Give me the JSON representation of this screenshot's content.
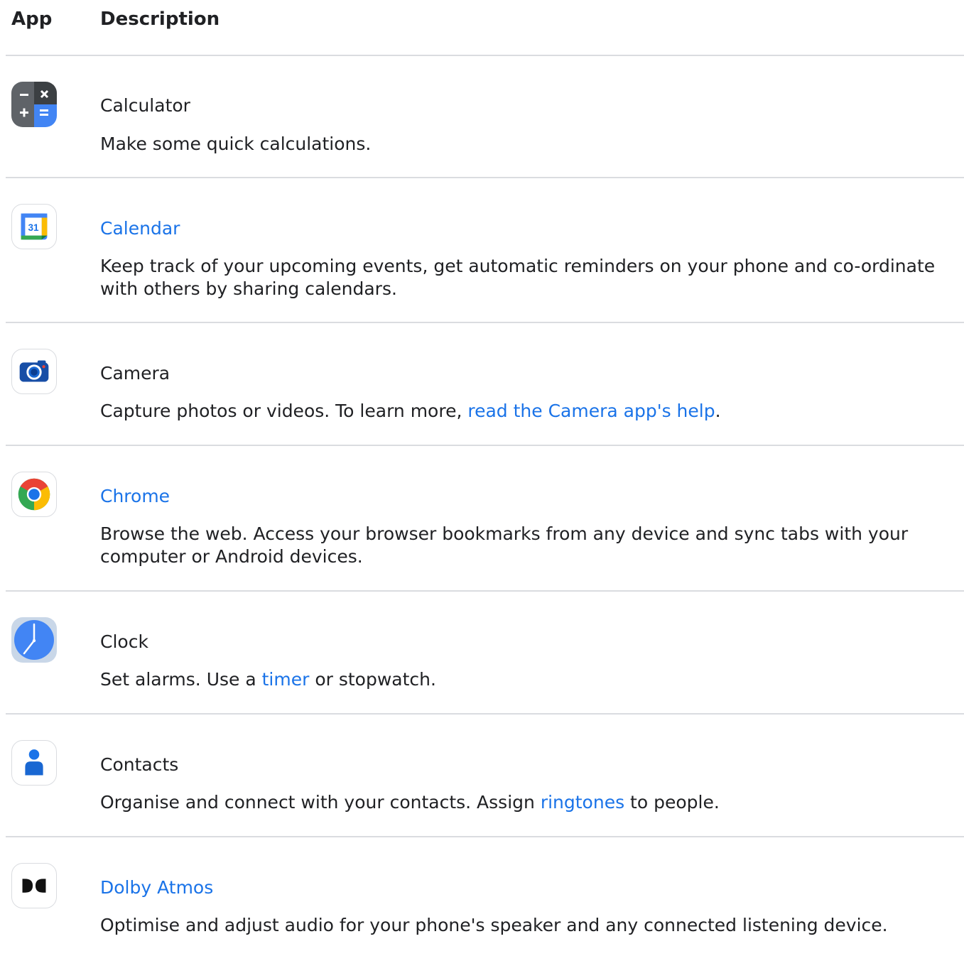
{
  "header": {
    "col_app": "App",
    "col_description": "Description"
  },
  "rows": [
    {
      "icon": "calculator-icon",
      "name": "Calculator",
      "desc": "Make some quick calculations."
    },
    {
      "icon": "calendar-icon",
      "name": "Calendar",
      "icon_text": "31",
      "desc": "Keep track of your upcoming events, get automatic reminders on your phone and co-ordinate with others by sharing calendars."
    },
    {
      "icon": "camera-icon",
      "name": "Camera",
      "desc_before": "Capture photos or videos. To learn more, ",
      "desc_link": "read the Camera app's help",
      "desc_after": "."
    },
    {
      "icon": "chrome-icon",
      "name": "Chrome",
      "desc": "Browse the web. Access your browser bookmarks from any device and sync tabs with your computer or Android devices."
    },
    {
      "icon": "clock-icon",
      "name": "Clock",
      "desc_before": "Set alarms. Use a ",
      "desc_link": "timer",
      "desc_after": " or stopwatch."
    },
    {
      "icon": "contacts-icon",
      "name": "Contacts",
      "desc_before": "Organise and connect with your contacts. Assign ",
      "desc_link": "ringtones",
      "desc_after": " to people."
    },
    {
      "icon": "dolby-atmos-icon",
      "name": "Dolby Atmos",
      "desc": "Optimise and adjust audio for your phone's speaker and any connected listening device."
    }
  ],
  "colors": {
    "link": "#1a73e8",
    "text": "#202124",
    "divider": "#dadce0"
  }
}
